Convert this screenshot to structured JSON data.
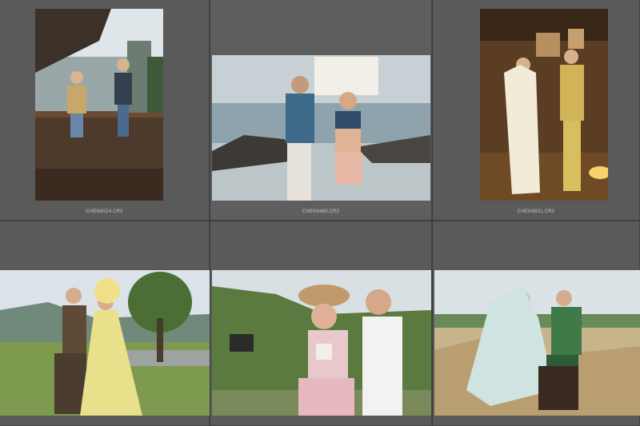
{
  "grid": {
    "cells": [
      {
        "filename": "CHEN9224.CR2"
      },
      {
        "filename": "CHEN9485.CR2"
      },
      {
        "filename": "CHEN9831.CR2"
      },
      {
        "filename": ""
      },
      {
        "filename": ""
      },
      {
        "filename": ""
      }
    ]
  }
}
